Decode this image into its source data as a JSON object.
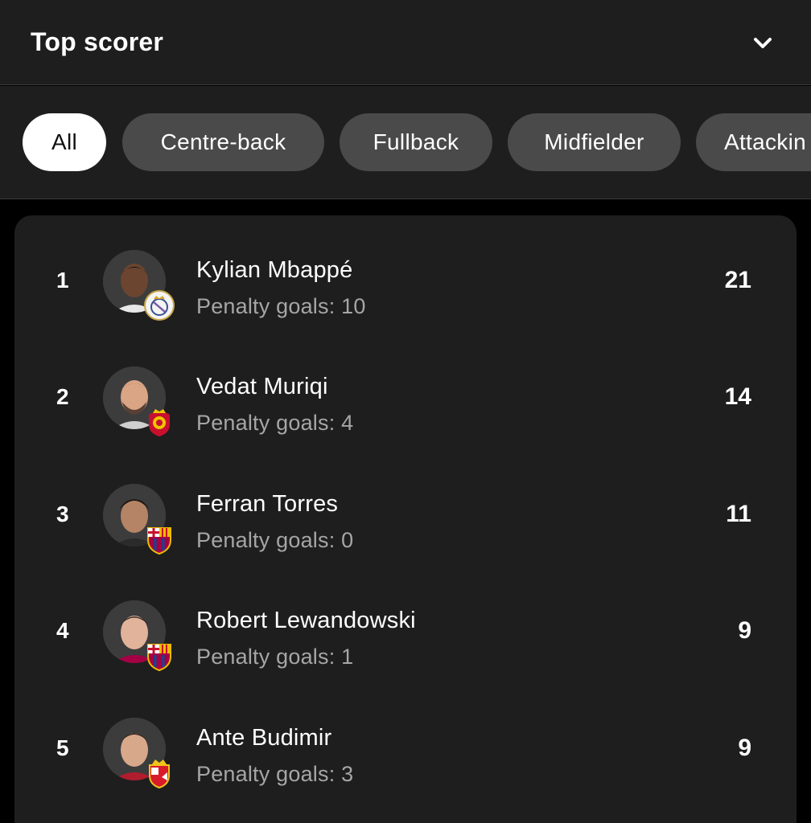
{
  "header": {
    "title": "Top scorer",
    "expand_icon": "chevron-down-icon"
  },
  "filters": [
    {
      "label": "All",
      "active": true
    },
    {
      "label": "Centre-back",
      "active": false
    },
    {
      "label": "Fullback",
      "active": false
    },
    {
      "label": "Midfielder",
      "active": false
    },
    {
      "label": "Attackin",
      "active": false
    }
  ],
  "players": [
    {
      "rank": "1",
      "name": "Kylian Mbappé",
      "penalty": "Penalty goals: 10",
      "goals": "21",
      "club_badge": "real-madrid-badge-icon"
    },
    {
      "rank": "2",
      "name": "Vedat Muriqi",
      "penalty": "Penalty goals: 4",
      "goals": "14",
      "club_badge": "mallorca-badge-icon"
    },
    {
      "rank": "3",
      "name": "Ferran Torres",
      "penalty": "Penalty goals: 0",
      "goals": "11",
      "club_badge": "barcelona-badge-icon"
    },
    {
      "rank": "4",
      "name": "Robert Lewandowski",
      "penalty": "Penalty goals: 1",
      "goals": "9",
      "club_badge": "barcelona-badge-icon"
    },
    {
      "rank": "5",
      "name": "Ante Budimir",
      "penalty": "Penalty goals: 3",
      "goals": "9",
      "club_badge": "osasuna-badge-icon"
    }
  ],
  "colors": {
    "background": "#000000",
    "panel": "#1e1e1e",
    "chip": "#4a4a4a",
    "chip_active": "#ffffff",
    "muted_text": "#a6a6a6"
  }
}
